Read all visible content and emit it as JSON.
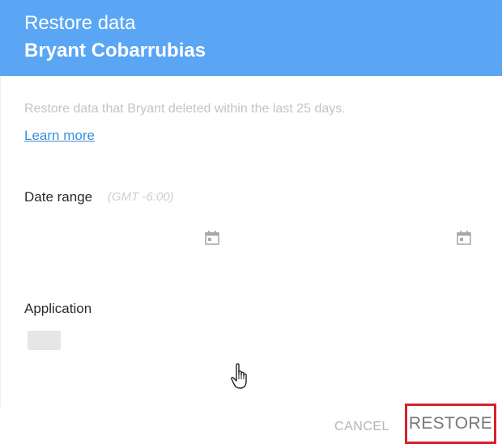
{
  "dialog": {
    "title": "Restore data",
    "user_name": "Bryant Cobarrubias",
    "description": "Restore data that Bryant deleted within the last 25 days.",
    "learn_more": "Learn more",
    "date_range": {
      "label": "Date range",
      "timezone": "(GMT -6:00)",
      "start_icon": "calendar-icon",
      "end_icon": "calendar-icon"
    },
    "application": {
      "label": "Application"
    },
    "buttons": {
      "cancel": "CANCEL",
      "restore": "RESTORE"
    }
  },
  "colors": {
    "header": "#5aa6f5",
    "link": "#3b8ed6",
    "highlight": "#d9202c"
  },
  "icons": {
    "cursor": "hand-pointer-icon"
  }
}
